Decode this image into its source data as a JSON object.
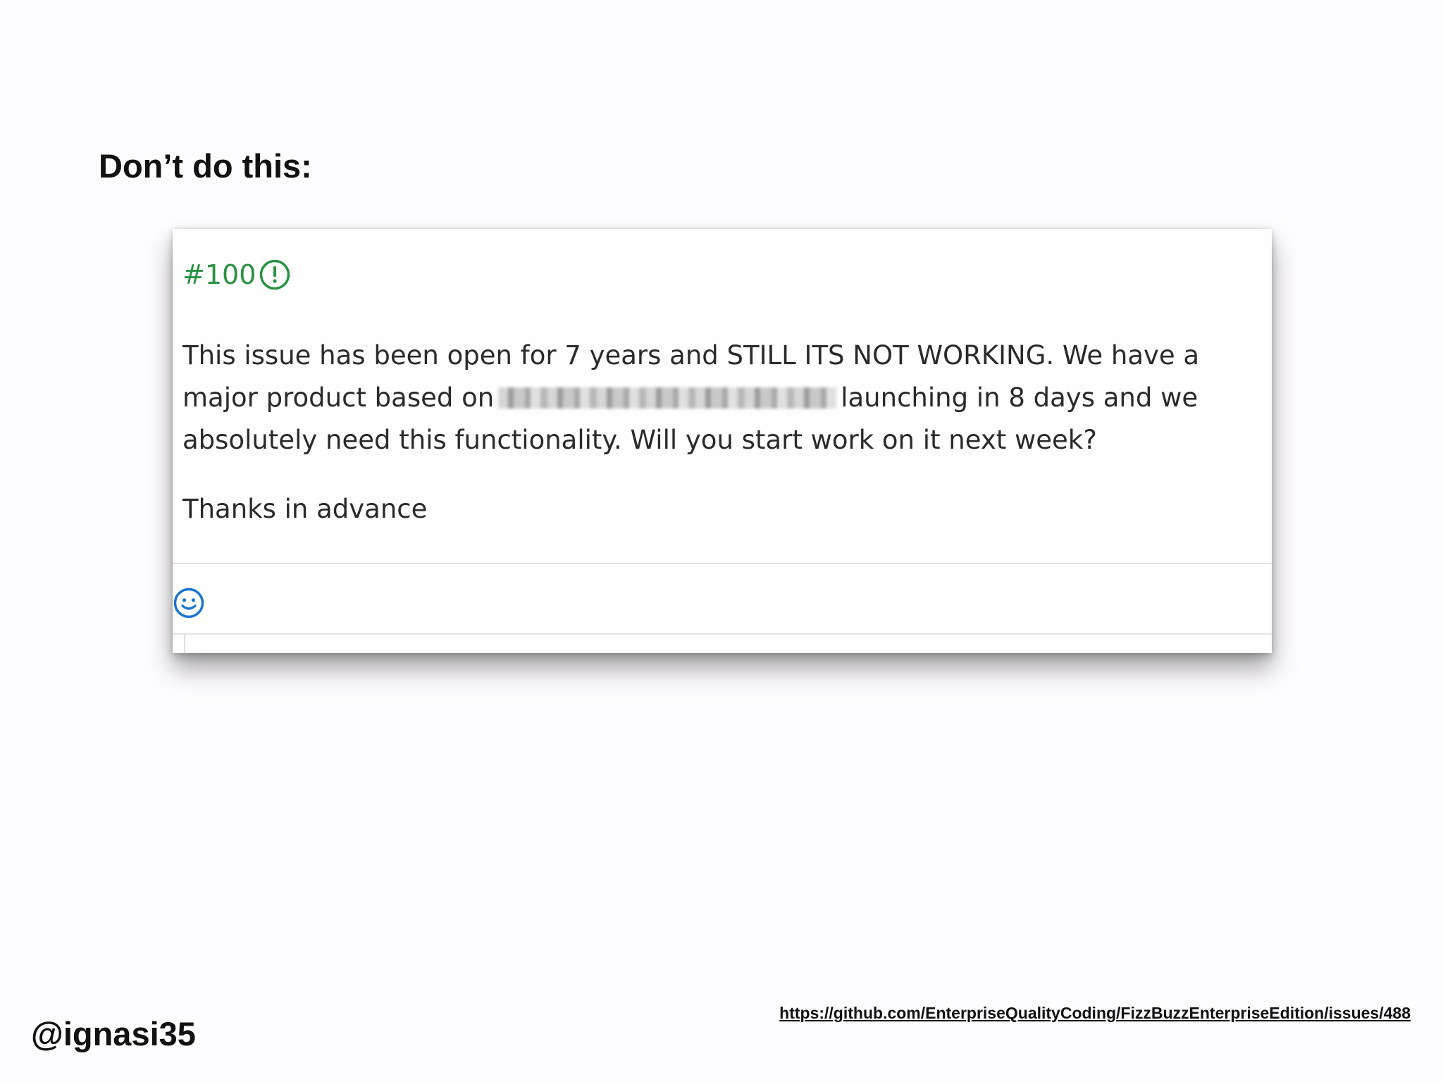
{
  "slide": {
    "heading": "Don’t do this:",
    "handle": "@ignasi35",
    "source_link": "https://github.com/EnterpriseQualityCoding/FizzBuzzEnterpriseEdition/issues/488"
  },
  "issue": {
    "number": "#100",
    "status_icon": "issue-open-icon",
    "status_color": "#2a9143",
    "paragraph": {
      "line1": "This issue has been open for 7 years and STILL ITS NOT WORKING. We have a",
      "line2_before": "major product based on",
      "line2_after": "launching in 8 days and we",
      "line3": "absolutely need this functionality. Will you start work on it next week?"
    },
    "closing": "Thanks in advance",
    "reaction_icon": "smiley-icon",
    "reaction_color": "#1b75d0"
  }
}
